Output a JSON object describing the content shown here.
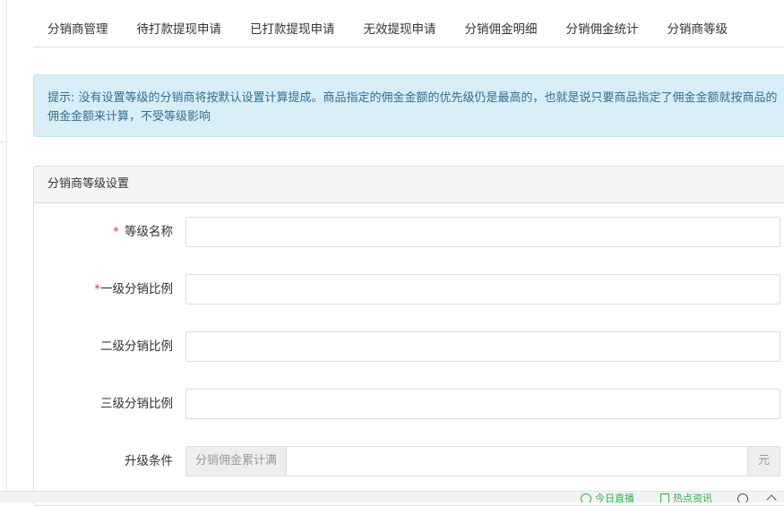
{
  "tabs": [
    {
      "label": "分销商管理"
    },
    {
      "label": "待打款提现申请"
    },
    {
      "label": "已打款提现申请"
    },
    {
      "label": "无效提现申请"
    },
    {
      "label": "分销佣金明细"
    },
    {
      "label": "分销佣金统计"
    },
    {
      "label": "分销商等级"
    }
  ],
  "alert": {
    "text": "提示: 没有设置等级的分销商将按默认设置计算提成。商品指定的佣金金额的优先级仍是最高的，也就是说只要商品指定了佣金金额就按商品的佣金金额来计算，不受等级影响"
  },
  "panel": {
    "title": "分销商等级设置",
    "required_mark": "*",
    "fields": {
      "level_name": {
        "label": "等级名称",
        "value": ""
      },
      "first_ratio": {
        "label": "一级分销比例",
        "value": ""
      },
      "second_ratio": {
        "label": "二级分销比例",
        "value": ""
      },
      "third_ratio": {
        "label": "三级分销比例",
        "value": ""
      },
      "upgrade": {
        "label": "升级条件",
        "prefix": "分销佣金累计满",
        "suffix": "元",
        "value": ""
      }
    }
  },
  "bottom_bar": {
    "items": [
      {
        "label": "今日直播",
        "icon": "live-icon",
        "color": "#2bb24c"
      },
      {
        "label": "热点资讯",
        "icon": "news-icon",
        "color": "#2bb24c"
      }
    ]
  }
}
